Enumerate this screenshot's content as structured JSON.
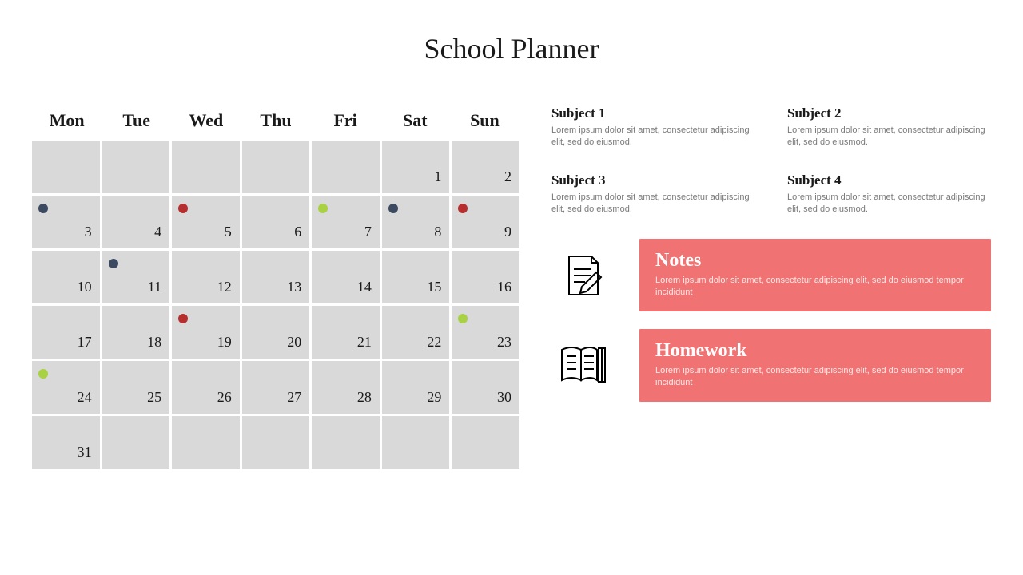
{
  "title": "School Planner",
  "weekdays": [
    "Mon",
    "Tue",
    "Wed",
    "Thu",
    "Fri",
    "Sat",
    "Sun"
  ],
  "cells": [
    {
      "num": "",
      "dot": ""
    },
    {
      "num": "",
      "dot": ""
    },
    {
      "num": "",
      "dot": ""
    },
    {
      "num": "",
      "dot": ""
    },
    {
      "num": "",
      "dot": ""
    },
    {
      "num": "1",
      "dot": ""
    },
    {
      "num": "2",
      "dot": ""
    },
    {
      "num": "3",
      "dot": "navy"
    },
    {
      "num": "4",
      "dot": ""
    },
    {
      "num": "5",
      "dot": "red"
    },
    {
      "num": "6",
      "dot": ""
    },
    {
      "num": "7",
      "dot": "green"
    },
    {
      "num": "8",
      "dot": "navy"
    },
    {
      "num": "9",
      "dot": "red"
    },
    {
      "num": "10",
      "dot": ""
    },
    {
      "num": "11",
      "dot": "navy"
    },
    {
      "num": "12",
      "dot": ""
    },
    {
      "num": "13",
      "dot": ""
    },
    {
      "num": "14",
      "dot": ""
    },
    {
      "num": "15",
      "dot": ""
    },
    {
      "num": "16",
      "dot": ""
    },
    {
      "num": "17",
      "dot": ""
    },
    {
      "num": "18",
      "dot": ""
    },
    {
      "num": "19",
      "dot": "red"
    },
    {
      "num": "20",
      "dot": ""
    },
    {
      "num": "21",
      "dot": ""
    },
    {
      "num": "22",
      "dot": ""
    },
    {
      "num": "23",
      "dot": "green"
    },
    {
      "num": "24",
      "dot": "green"
    },
    {
      "num": "25",
      "dot": ""
    },
    {
      "num": "26",
      "dot": ""
    },
    {
      "num": "27",
      "dot": ""
    },
    {
      "num": "28",
      "dot": ""
    },
    {
      "num": "29",
      "dot": ""
    },
    {
      "num": "30",
      "dot": ""
    },
    {
      "num": "31",
      "dot": ""
    },
    {
      "num": "",
      "dot": ""
    },
    {
      "num": "",
      "dot": ""
    },
    {
      "num": "",
      "dot": ""
    },
    {
      "num": "",
      "dot": ""
    },
    {
      "num": "",
      "dot": ""
    },
    {
      "num": "",
      "dot": ""
    }
  ],
  "subjects": [
    {
      "title": "Subject 1",
      "body": "Lorem ipsum dolor sit amet, consectetur adipiscing elit, sed do eiusmod."
    },
    {
      "title": "Subject 2",
      "body": "Lorem ipsum dolor sit amet, consectetur adipiscing elit, sed do eiusmod."
    },
    {
      "title": "Subject 3",
      "body": "Lorem ipsum dolor sit amet, consectetur adipiscing elit, sed do eiusmod."
    },
    {
      "title": "Subject 4",
      "body": "Lorem ipsum dolor sit amet, consectetur adipiscing elit, sed do eiusmod."
    }
  ],
  "notes": {
    "title": "Notes",
    "body": "Lorem ipsum dolor sit amet, consectetur adipiscing elit, sed do eiusmod tempor incididunt"
  },
  "homework": {
    "title": "Homework",
    "body": "Lorem ipsum dolor sit amet, consectetur adipiscing elit, sed do eiusmod tempor incididunt"
  }
}
